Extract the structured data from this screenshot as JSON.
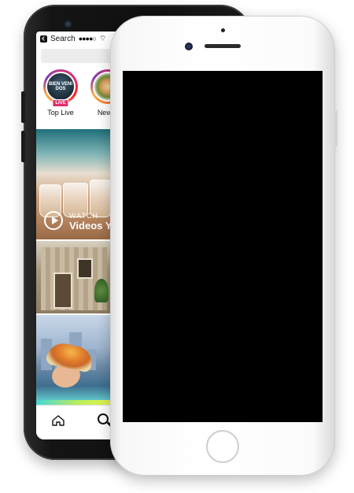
{
  "status_bar": {
    "back_app_label": "Search",
    "signal_dots": "●●●●○",
    "wifi_glyph": "⌔"
  },
  "stories": [
    {
      "label": "Top Live",
      "badge": "LIVE",
      "avatar_text": "BIEN VENI DOS"
    },
    {
      "label": "New Y"
    }
  ],
  "feed": {
    "watch_kicker": "WATCH",
    "watch_title": "Videos Y"
  },
  "tab_bar": {
    "icons": [
      "home-icon",
      "search-icon"
    ]
  },
  "colors": {
    "back_phone_body": "#111111",
    "front_phone_body": "#ffffff",
    "front_screen": "#000000",
    "live_badge": "#e1306c"
  }
}
